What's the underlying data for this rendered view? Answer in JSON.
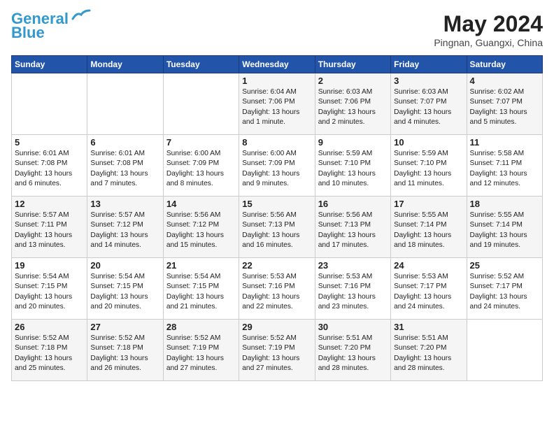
{
  "header": {
    "logo_line1": "General",
    "logo_line2": "Blue",
    "month": "May 2024",
    "location": "Pingnan, Guangxi, China"
  },
  "weekdays": [
    "Sunday",
    "Monday",
    "Tuesday",
    "Wednesday",
    "Thursday",
    "Friday",
    "Saturday"
  ],
  "weeks": [
    [
      {
        "day": "",
        "info": ""
      },
      {
        "day": "",
        "info": ""
      },
      {
        "day": "",
        "info": ""
      },
      {
        "day": "1",
        "info": "Sunrise: 6:04 AM\nSunset: 7:06 PM\nDaylight: 13 hours\nand 1 minute."
      },
      {
        "day": "2",
        "info": "Sunrise: 6:03 AM\nSunset: 7:06 PM\nDaylight: 13 hours\nand 2 minutes."
      },
      {
        "day": "3",
        "info": "Sunrise: 6:03 AM\nSunset: 7:07 PM\nDaylight: 13 hours\nand 4 minutes."
      },
      {
        "day": "4",
        "info": "Sunrise: 6:02 AM\nSunset: 7:07 PM\nDaylight: 13 hours\nand 5 minutes."
      }
    ],
    [
      {
        "day": "5",
        "info": "Sunrise: 6:01 AM\nSunset: 7:08 PM\nDaylight: 13 hours\nand 6 minutes."
      },
      {
        "day": "6",
        "info": "Sunrise: 6:01 AM\nSunset: 7:08 PM\nDaylight: 13 hours\nand 7 minutes."
      },
      {
        "day": "7",
        "info": "Sunrise: 6:00 AM\nSunset: 7:09 PM\nDaylight: 13 hours\nand 8 minutes."
      },
      {
        "day": "8",
        "info": "Sunrise: 6:00 AM\nSunset: 7:09 PM\nDaylight: 13 hours\nand 9 minutes."
      },
      {
        "day": "9",
        "info": "Sunrise: 5:59 AM\nSunset: 7:10 PM\nDaylight: 13 hours\nand 10 minutes."
      },
      {
        "day": "10",
        "info": "Sunrise: 5:59 AM\nSunset: 7:10 PM\nDaylight: 13 hours\nand 11 minutes."
      },
      {
        "day": "11",
        "info": "Sunrise: 5:58 AM\nSunset: 7:11 PM\nDaylight: 13 hours\nand 12 minutes."
      }
    ],
    [
      {
        "day": "12",
        "info": "Sunrise: 5:57 AM\nSunset: 7:11 PM\nDaylight: 13 hours\nand 13 minutes."
      },
      {
        "day": "13",
        "info": "Sunrise: 5:57 AM\nSunset: 7:12 PM\nDaylight: 13 hours\nand 14 minutes."
      },
      {
        "day": "14",
        "info": "Sunrise: 5:56 AM\nSunset: 7:12 PM\nDaylight: 13 hours\nand 15 minutes."
      },
      {
        "day": "15",
        "info": "Sunrise: 5:56 AM\nSunset: 7:13 PM\nDaylight: 13 hours\nand 16 minutes."
      },
      {
        "day": "16",
        "info": "Sunrise: 5:56 AM\nSunset: 7:13 PM\nDaylight: 13 hours\nand 17 minutes."
      },
      {
        "day": "17",
        "info": "Sunrise: 5:55 AM\nSunset: 7:14 PM\nDaylight: 13 hours\nand 18 minutes."
      },
      {
        "day": "18",
        "info": "Sunrise: 5:55 AM\nSunset: 7:14 PM\nDaylight: 13 hours\nand 19 minutes."
      }
    ],
    [
      {
        "day": "19",
        "info": "Sunrise: 5:54 AM\nSunset: 7:15 PM\nDaylight: 13 hours\nand 20 minutes."
      },
      {
        "day": "20",
        "info": "Sunrise: 5:54 AM\nSunset: 7:15 PM\nDaylight: 13 hours\nand 20 minutes."
      },
      {
        "day": "21",
        "info": "Sunrise: 5:54 AM\nSunset: 7:15 PM\nDaylight: 13 hours\nand 21 minutes."
      },
      {
        "day": "22",
        "info": "Sunrise: 5:53 AM\nSunset: 7:16 PM\nDaylight: 13 hours\nand 22 minutes."
      },
      {
        "day": "23",
        "info": "Sunrise: 5:53 AM\nSunset: 7:16 PM\nDaylight: 13 hours\nand 23 minutes."
      },
      {
        "day": "24",
        "info": "Sunrise: 5:53 AM\nSunset: 7:17 PM\nDaylight: 13 hours\nand 24 minutes."
      },
      {
        "day": "25",
        "info": "Sunrise: 5:52 AM\nSunset: 7:17 PM\nDaylight: 13 hours\nand 24 minutes."
      }
    ],
    [
      {
        "day": "26",
        "info": "Sunrise: 5:52 AM\nSunset: 7:18 PM\nDaylight: 13 hours\nand 25 minutes."
      },
      {
        "day": "27",
        "info": "Sunrise: 5:52 AM\nSunset: 7:18 PM\nDaylight: 13 hours\nand 26 minutes."
      },
      {
        "day": "28",
        "info": "Sunrise: 5:52 AM\nSunset: 7:19 PM\nDaylight: 13 hours\nand 27 minutes."
      },
      {
        "day": "29",
        "info": "Sunrise: 5:52 AM\nSunset: 7:19 PM\nDaylight: 13 hours\nand 27 minutes."
      },
      {
        "day": "30",
        "info": "Sunrise: 5:51 AM\nSunset: 7:20 PM\nDaylight: 13 hours\nand 28 minutes."
      },
      {
        "day": "31",
        "info": "Sunrise: 5:51 AM\nSunset: 7:20 PM\nDaylight: 13 hours\nand 28 minutes."
      },
      {
        "day": "",
        "info": ""
      }
    ]
  ]
}
